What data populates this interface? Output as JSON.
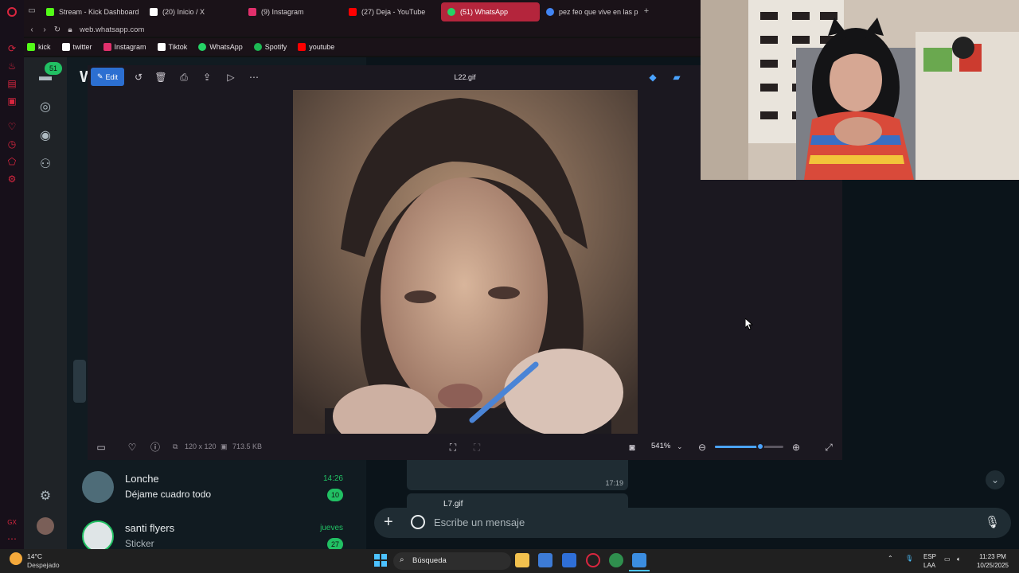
{
  "browser": {
    "tabs": [
      {
        "label": "Stream - Kick Dashboard",
        "color": "#53fc18"
      },
      {
        "label": "(20) Inicio / X",
        "color": "#ffffff"
      },
      {
        "label": "(9) Instagram",
        "color": "#e1306c"
      },
      {
        "label": "(27) Deja - YouTube",
        "color": "#ff0000"
      },
      {
        "label": "(51) WhatsApp",
        "color": "#25d366",
        "active": true
      },
      {
        "label": "pez feo que vive en las pr",
        "color": "#4285f4"
      }
    ],
    "new_tab": "+",
    "url": "web.whatsapp.com",
    "bookmarks": [
      {
        "label": "kick",
        "color": "#53fc18"
      },
      {
        "label": "twitter",
        "color": "#ffffff"
      },
      {
        "label": "Instagram",
        "color": "#e1306c"
      },
      {
        "label": "Tiktok",
        "color": "#ffffff"
      },
      {
        "label": "WhatsApp",
        "color": "#25d366"
      },
      {
        "label": "Spotify",
        "color": "#1db954"
      },
      {
        "label": "youtube",
        "color": "#ff0000"
      }
    ],
    "sidebar_gx": "GX"
  },
  "whatsapp": {
    "unread_badge": "51",
    "header_initial": "W",
    "chats": [
      {
        "name": "Lonche",
        "message": "Déjame cuadro todo",
        "time": "14:26",
        "unread": "10"
      },
      {
        "name": "santi flyers",
        "message": "Sticker",
        "time": "jueves",
        "unread": "27"
      }
    ],
    "message_time": "17:19",
    "partial_file": "L7.gif",
    "composer_placeholder": "Escribe un mensaje"
  },
  "viewer": {
    "edit_label": "Edit",
    "file_name": "L22.gif",
    "dimensions": "120 x 120",
    "file_size": "713.5 KB",
    "zoom": "541%",
    "zoom_fraction": 0.66
  },
  "taskbar": {
    "weather_temp": "14°C",
    "weather_desc": "Despejado",
    "search_label": "Búsqueda",
    "lang_top": "ESP",
    "lang_bottom": "LAA",
    "time": "11:23 PM",
    "date": "10/25/2025"
  }
}
